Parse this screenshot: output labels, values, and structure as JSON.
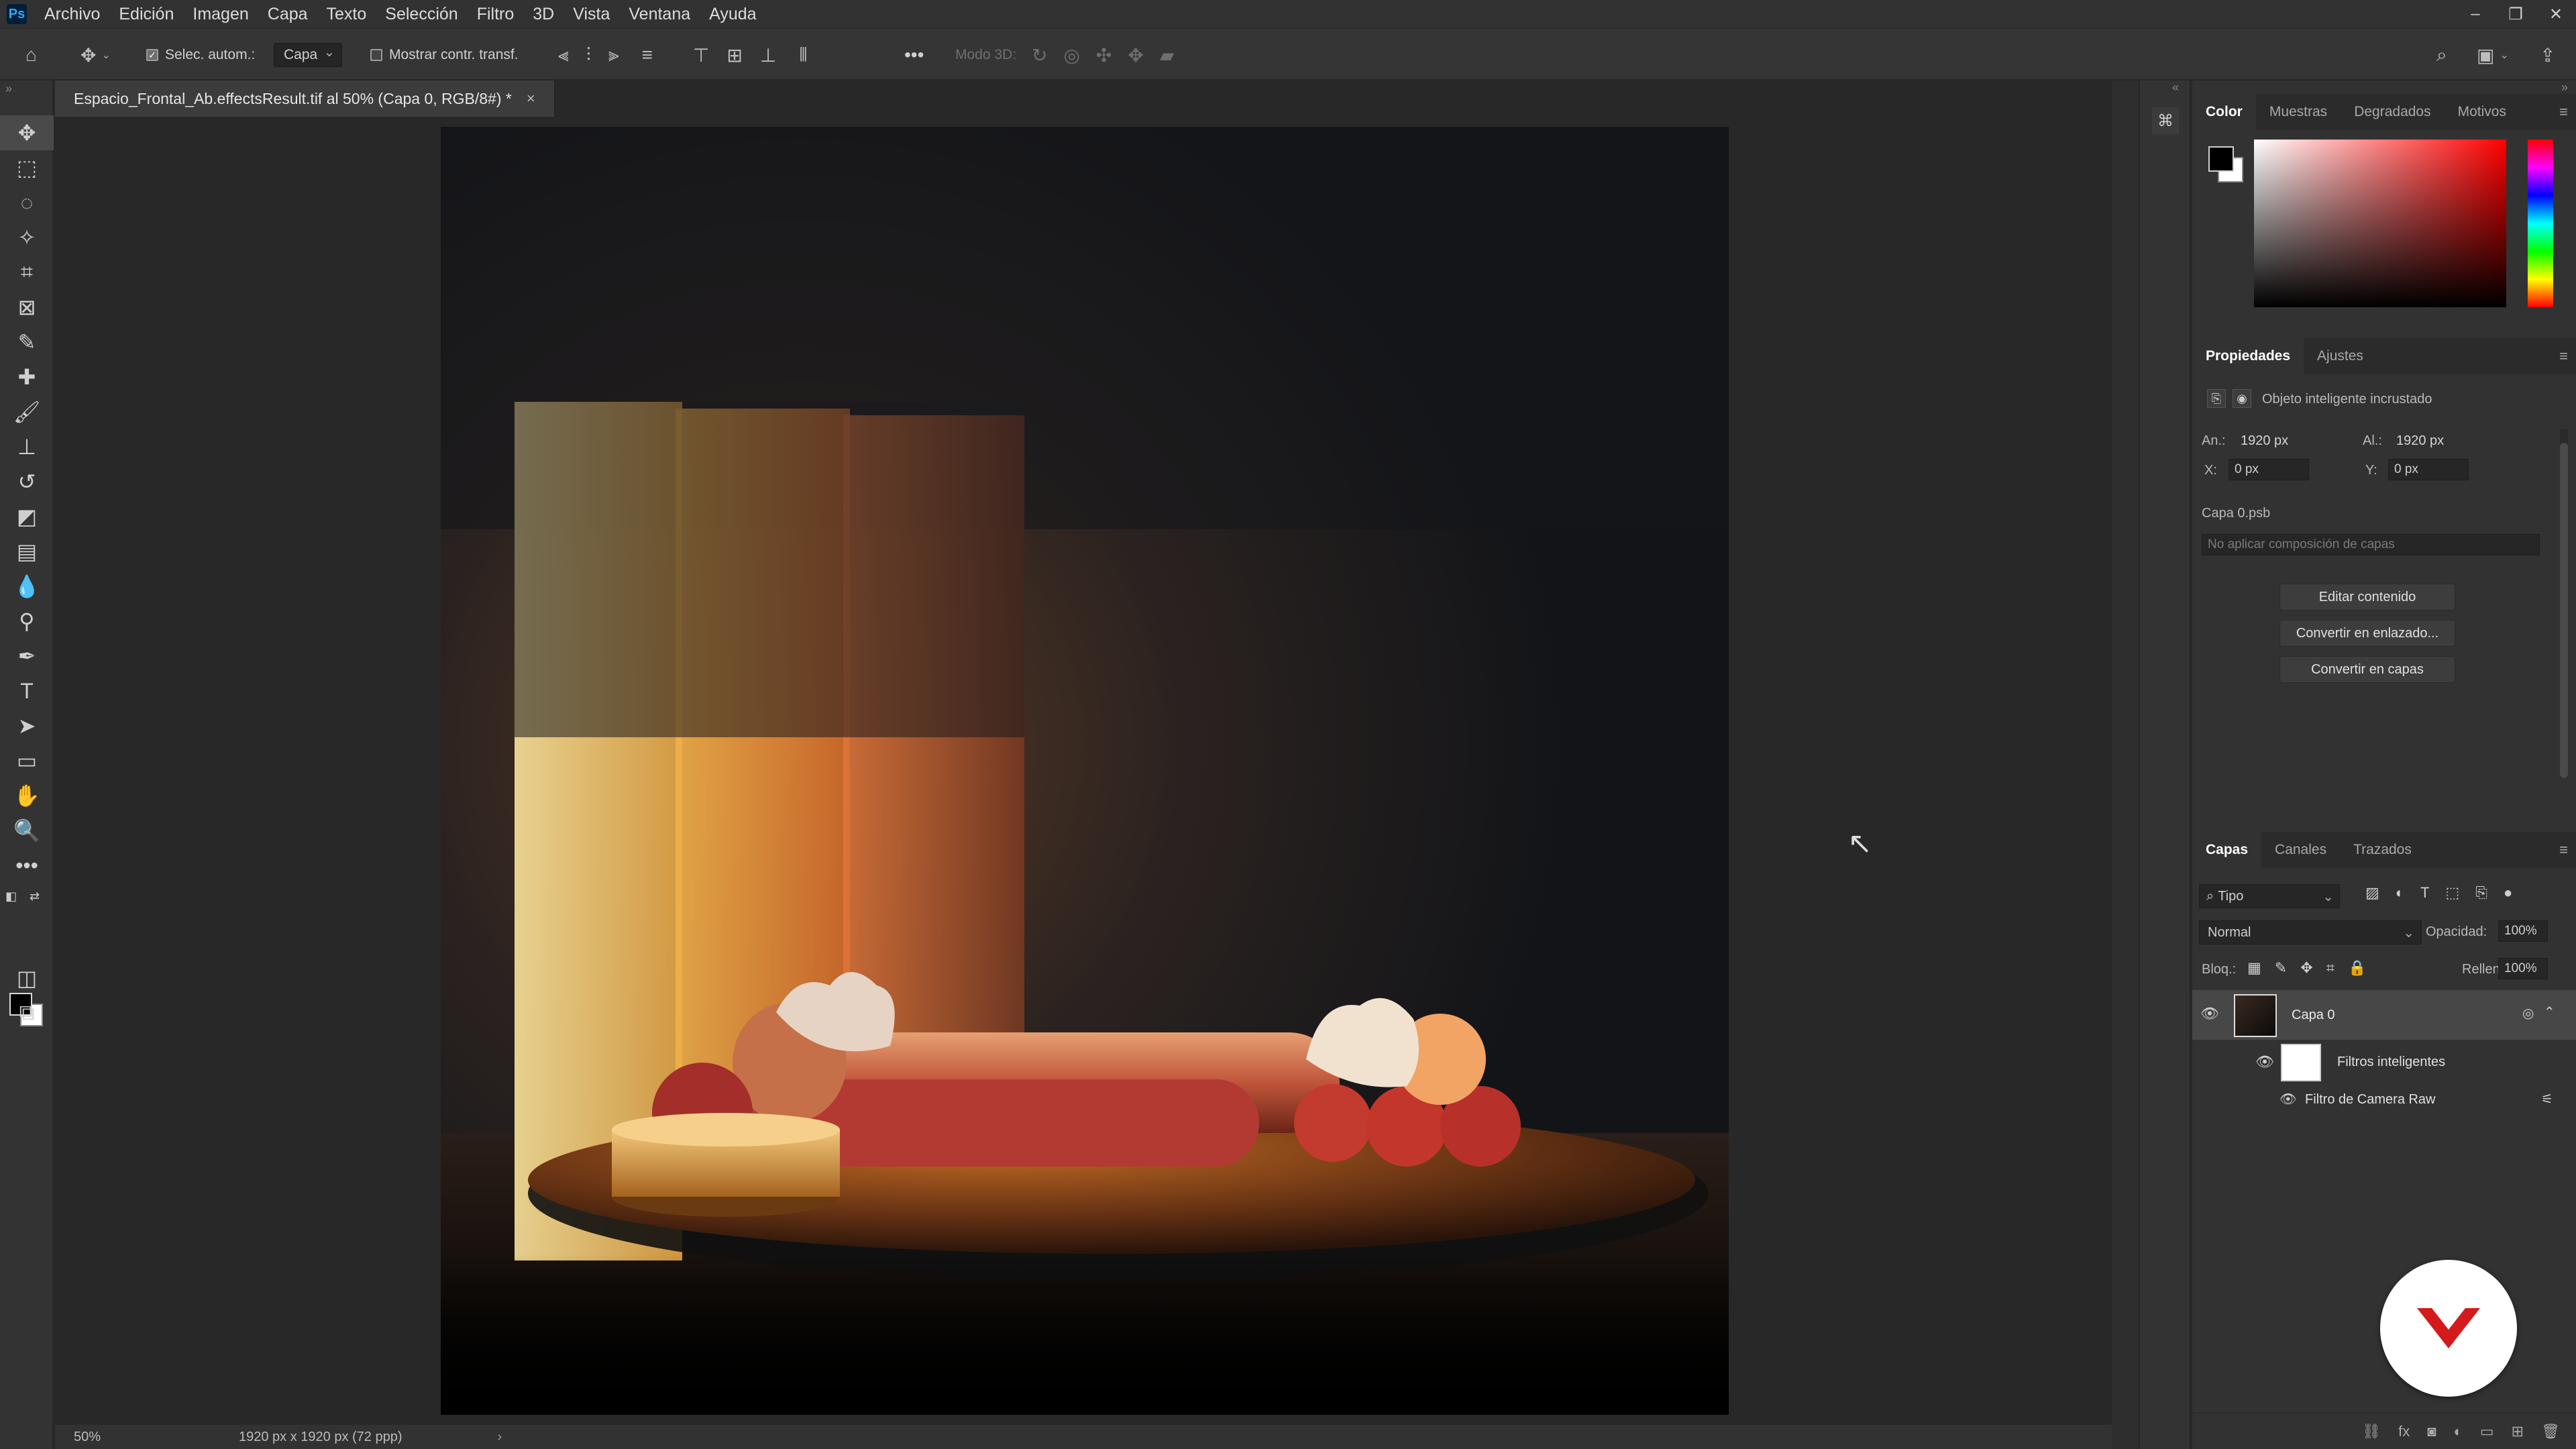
{
  "menu": {
    "logo": "Ps",
    "items": [
      "Archivo",
      "Edición",
      "Imagen",
      "Capa",
      "Texto",
      "Selección",
      "Filtro",
      "3D",
      "Vista",
      "Ventana",
      "Ayuda"
    ]
  },
  "window_controls": {
    "minimize": "–",
    "restore": "❐",
    "close": "✕"
  },
  "options_bar": {
    "auto_select_label": "Selec. autom.:",
    "auto_select_target": "Capa",
    "show_transform_label": "Mostrar contr. transf.",
    "mode_3d_label": "Modo 3D:",
    "more": "•••"
  },
  "document": {
    "tab_title": "Espacio_Frontal_Ab.effectsResult.tif al 50% (Capa 0, RGB/8#) *",
    "close": "×"
  },
  "status": {
    "zoom": "50%",
    "size": "1920 px x 1920 px (72 ppp)",
    "arrow": "›"
  },
  "color_panel": {
    "tabs": [
      "Color",
      "Muestras",
      "Degradados",
      "Motivos"
    ],
    "active_tab": 0,
    "foreground": "#000000",
    "background": "#ffffff",
    "hue_color": "#ff0000"
  },
  "properties_panel": {
    "tabs": [
      "Propiedades",
      "Ajustes"
    ],
    "active_tab": 0,
    "object_type": "Objeto inteligente incrustado",
    "width_label": "An.:",
    "width_value": "1920 px",
    "height_label": "Al.:",
    "height_value": "1920 px",
    "x_label": "X:",
    "x_value": "0 px",
    "y_label": "Y:",
    "y_value": "0 px",
    "source_file": "Capa 0.psb",
    "composition_placeholder": "No aplicar composición de capas",
    "buttons": {
      "edit": "Editar contenido",
      "convert_linked": "Convertir en enlazado...",
      "convert_layers": "Convertir en capas"
    }
  },
  "layers_panel": {
    "tabs": [
      "Capas",
      "Canales",
      "Trazados"
    ],
    "active_tab": 0,
    "filter_kind": "Tipo",
    "blend_mode": "Normal",
    "opacity_label": "Opacidad:",
    "opacity_value": "100%",
    "lock_label": "Bloq.:",
    "fill_label": "Relleno:",
    "fill_value": "100%",
    "layers": [
      {
        "name": "Capa 0",
        "selected": true
      },
      {
        "name": "Filtros inteligentes"
      },
      {
        "name": "Filtro de Camera Raw"
      }
    ]
  }
}
